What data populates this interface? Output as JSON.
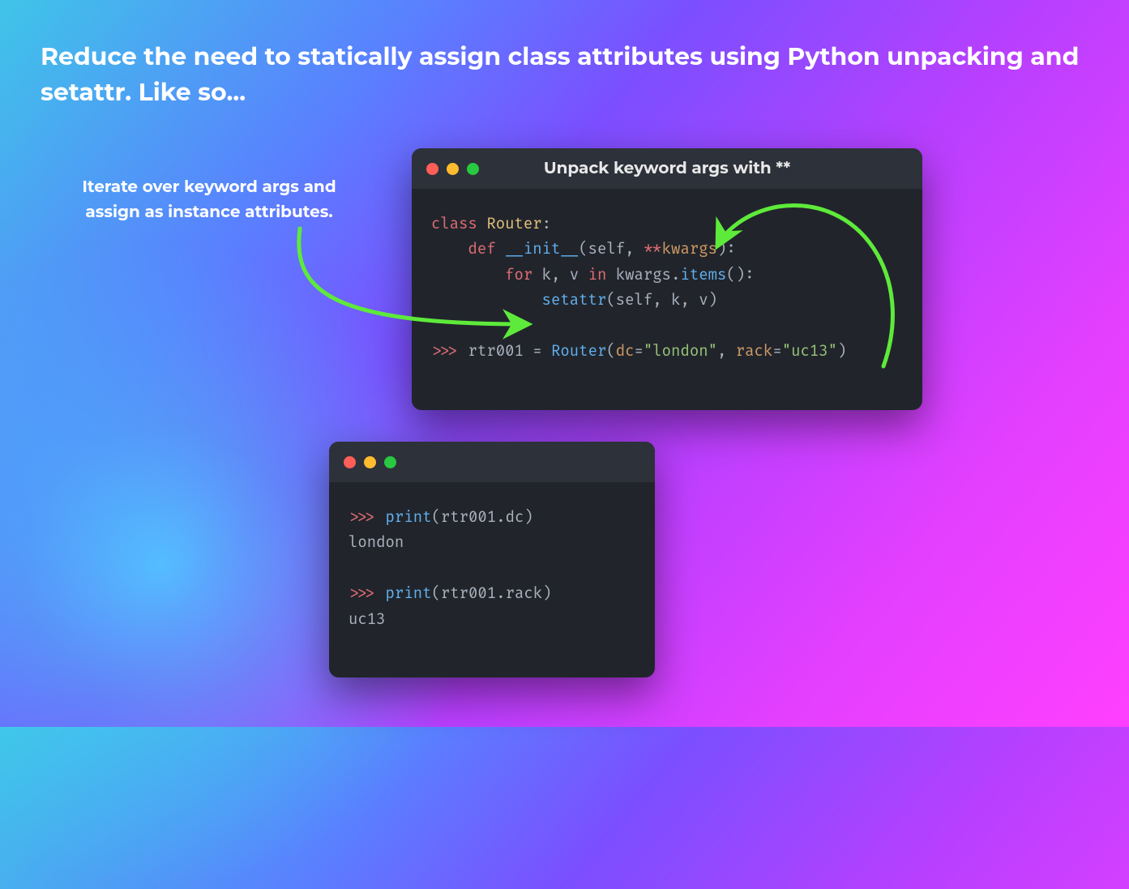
{
  "heading": "Reduce the need to statically assign class attributes using Python unpacking and setattr. Like so...",
  "caption": "Iterate over keyword args and assign as instance attributes.",
  "window1": {
    "title": "Unpack keyword args with **",
    "code": {
      "kw_class": "class",
      "cls_name": "Router",
      "colon": ":",
      "kw_def": "def",
      "init": "__init__",
      "self": "self",
      "stars": "**",
      "kwargs": "kwargs",
      "kw_for": "for",
      "var_k": "k",
      "var_v": "v",
      "kw_in": "in",
      "items": "items",
      "setattr": "setattr",
      "prompt": ">>>",
      "rtr": "rtr001",
      "eq": "=",
      "call": "Router",
      "arg1": "dc",
      "val1": "\"london\"",
      "arg2": "rack",
      "val2": "\"uc13\""
    }
  },
  "window2": {
    "code": {
      "prompt": ">>>",
      "print": "print",
      "rtr": "rtr001",
      "attr1": "dc",
      "out1": "london",
      "attr2": "rack",
      "out2": "uc13"
    }
  }
}
